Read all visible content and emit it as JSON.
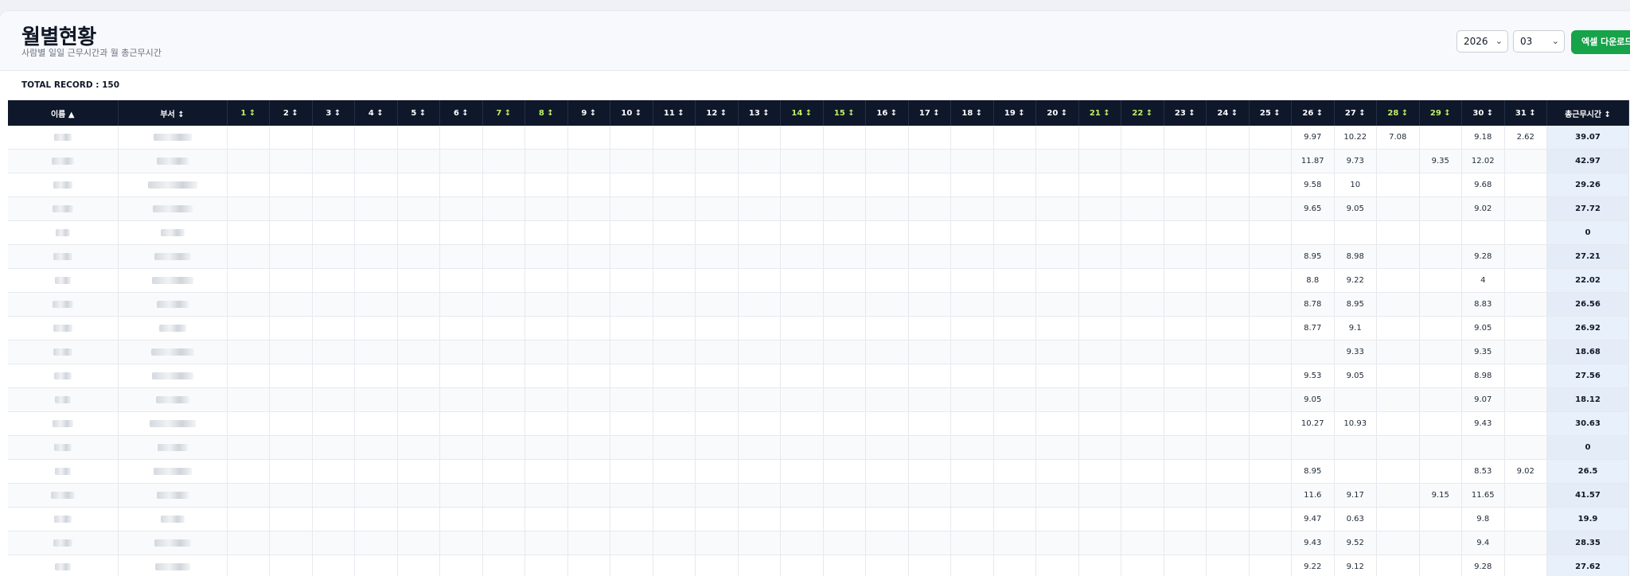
{
  "header": {
    "title": "월별현황",
    "subtitle": "사람별 일일 근무시간과 월 총근무시간"
  },
  "controls": {
    "year": "2026",
    "month": "03",
    "download_label": "엑셀 다운로드"
  },
  "record_label": "TOTAL RECORD : 150",
  "table": {
    "columns": [
      "이름 ▲",
      "부서 ↕",
      "1 ↕",
      "2 ↕",
      "3 ↕",
      "4 ↕",
      "5 ↕",
      "6 ↕",
      "7 ↕",
      "8 ↕",
      "9 ↕",
      "10 ↕",
      "11 ↕",
      "12 ↕",
      "13 ↕",
      "14 ↕",
      "15 ↕",
      "16 ↕",
      "17 ↕",
      "18 ↕",
      "19 ↕",
      "20 ↕",
      "21 ↕",
      "22 ↕",
      "23 ↕",
      "24 ↕",
      "25 ↕",
      "26 ↕",
      "27 ↕",
      "28 ↕",
      "29 ↕",
      "30 ↕",
      "31 ↕",
      "총근무시간 ↕"
    ],
    "weekend_days": [
      1,
      7,
      8,
      14,
      15,
      21,
      22,
      28,
      29
    ],
    "rows": [
      {
        "d26": "9.97",
        "d27": "10.22",
        "d28": "7.08",
        "d29": "",
        "d30": "9.18",
        "d31": "2.62",
        "total": "39.07"
      },
      {
        "d26": "11.87",
        "d27": "9.73",
        "d28": "",
        "d29": "9.35",
        "d30": "12.02",
        "d31": "",
        "total": "42.97"
      },
      {
        "d26": "9.58",
        "d27": "10",
        "d28": "",
        "d29": "",
        "d30": "9.68",
        "d31": "",
        "total": "29.26"
      },
      {
        "d26": "9.65",
        "d27": "9.05",
        "d28": "",
        "d29": "",
        "d30": "9.02",
        "d31": "",
        "total": "27.72"
      },
      {
        "d26": "",
        "d27": "",
        "d28": "",
        "d29": "",
        "d30": "",
        "d31": "",
        "total": "0"
      },
      {
        "d26": "8.95",
        "d27": "8.98",
        "d28": "",
        "d29": "",
        "d30": "9.28",
        "d31": "",
        "total": "27.21"
      },
      {
        "d26": "8.8",
        "d27": "9.22",
        "d28": "",
        "d29": "",
        "d30": "4",
        "d31": "",
        "total": "22.02"
      },
      {
        "d26": "8.78",
        "d27": "8.95",
        "d28": "",
        "d29": "",
        "d30": "8.83",
        "d31": "",
        "total": "26.56"
      },
      {
        "d26": "8.77",
        "d27": "9.1",
        "d28": "",
        "d29": "",
        "d30": "9.05",
        "d31": "",
        "total": "26.92"
      },
      {
        "d26": "",
        "d27": "9.33",
        "d28": "",
        "d29": "",
        "d30": "9.35",
        "d31": "",
        "total": "18.68"
      },
      {
        "d26": "9.53",
        "d27": "9.05",
        "d28": "",
        "d29": "",
        "d30": "8.98",
        "d31": "",
        "total": "27.56"
      },
      {
        "d26": "9.05",
        "d27": "",
        "d28": "",
        "d29": "",
        "d30": "9.07",
        "d31": "",
        "total": "18.12"
      },
      {
        "d26": "10.27",
        "d27": "10.93",
        "d28": "",
        "d29": "",
        "d30": "9.43",
        "d31": "",
        "total": "30.63"
      },
      {
        "d26": "",
        "d27": "",
        "d28": "",
        "d29": "",
        "d30": "",
        "d31": "",
        "total": "0"
      },
      {
        "d26": "8.95",
        "d27": "",
        "d28": "",
        "d29": "",
        "d30": "8.53",
        "d31": "9.02",
        "total": "26.5"
      },
      {
        "d26": "11.6",
        "d27": "9.17",
        "d28": "",
        "d29": "9.15",
        "d30": "11.65",
        "d31": "",
        "total": "41.57"
      },
      {
        "d26": "9.47",
        "d27": "0.63",
        "d28": "",
        "d29": "",
        "d30": "9.8",
        "d31": "",
        "total": "19.9"
      },
      {
        "d26": "9.43",
        "d27": "9.52",
        "d28": "",
        "d29": "",
        "d30": "9.4",
        "d31": "",
        "total": "28.35"
      },
      {
        "d26": "9.22",
        "d27": "9.12",
        "d28": "",
        "d29": "",
        "d30": "9.28",
        "d31": "",
        "total": "27.62"
      }
    ]
  },
  "colors": {
    "header_bg": "#0f172a",
    "weekend_header": "#bef264",
    "download_button": "#16a34a",
    "total_cell": "#e8f0fb"
  }
}
